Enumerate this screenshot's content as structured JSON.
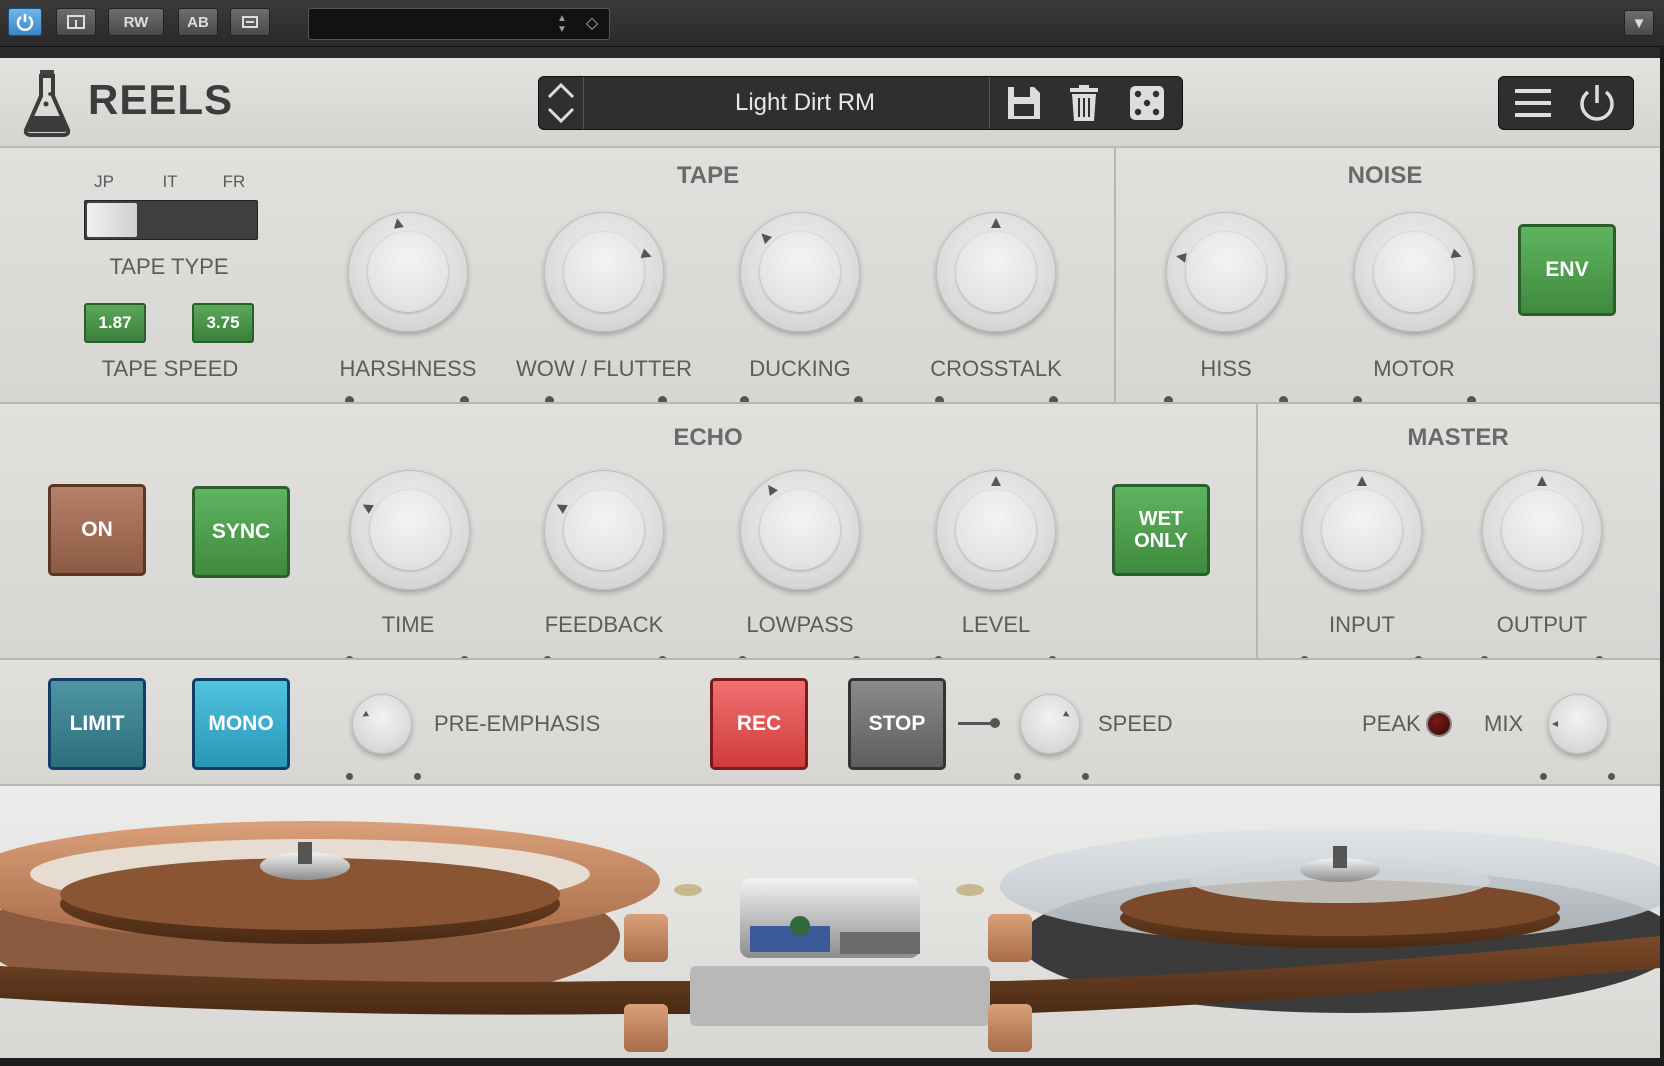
{
  "host": {
    "power_icon": "power-icon",
    "rw_label": "RW",
    "ab_label": "AB"
  },
  "header": {
    "app_name": "REELS",
    "preset_name": "Light Dirt RM"
  },
  "tape": {
    "title": "TAPE",
    "type_options": [
      "JP",
      "IT",
      "FR"
    ],
    "type_label": "TAPE TYPE",
    "speeds": [
      "1.87",
      "3.75"
    ],
    "speed_label": "TAPE SPEED",
    "knobs": [
      "HARSHNESS",
      "WOW / FLUTTER",
      "DUCKING",
      "CROSSTALK"
    ]
  },
  "noise": {
    "title": "NOISE",
    "knobs": [
      "HISS",
      "MOTOR"
    ],
    "env_label": "ENV"
  },
  "echo": {
    "title": "ECHO",
    "on_label": "ON",
    "sync_label": "SYNC",
    "knobs": [
      "TIME",
      "FEEDBACK",
      "LOWPASS",
      "LEVEL"
    ],
    "wet_only_label": "WET ONLY"
  },
  "master": {
    "title": "MASTER",
    "knobs": [
      "INPUT",
      "OUTPUT"
    ]
  },
  "bottom": {
    "limit_label": "LIMIT",
    "mono_label": "MONO",
    "pre_emphasis_label": "PRE-EMPHASIS",
    "rec_label": "REC",
    "stop_label": "STOP",
    "speed_label": "SPEED",
    "peak_label": "PEAK",
    "mix_label": "MIX"
  },
  "colors": {
    "accent_green": "#4a9a4a",
    "rec_red": "#e04a4a",
    "mono_cyan": "#3bb0d0",
    "on_brown": "#a06a52"
  }
}
